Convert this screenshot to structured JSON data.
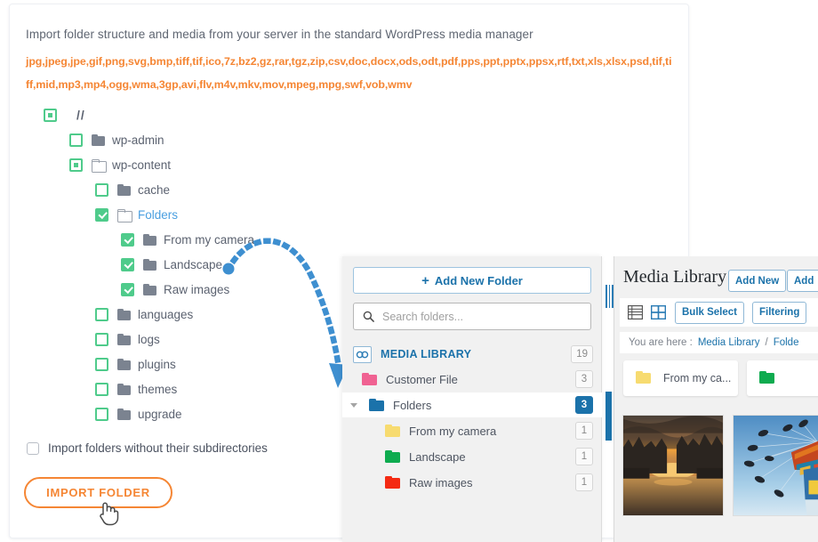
{
  "import_panel": {
    "intro": "Import folder structure and media from your server in the standard WordPress media manager",
    "extensions": "jpg,jpeg,jpe,gif,png,svg,bmp,tiff,tif,ico,7z,bz2,gz,rar,tgz,zip,csv,doc,docx,ods,odt,pdf,pps,ppt,pptx,ppsx,rtf,txt,xls,xlsx,psd,tif,tiff,mid,mp3,mp4,ogg,wma,3gp,avi,flv,m4v,mkv,mov,mpeg,mpg,swf,vob,wmv",
    "accent_color": "#f58634",
    "check_color": "#4fcb8b",
    "root_label": "//",
    "tree": [
      {
        "label": "wp-admin",
        "depth": 1,
        "state": "unchecked",
        "icon": "folder-solid-icon",
        "selected": false
      },
      {
        "label": "wp-content",
        "depth": 1,
        "state": "indeterminate",
        "icon": "folder-open-icon",
        "selected": false
      },
      {
        "label": "cache",
        "depth": 2,
        "state": "unchecked",
        "icon": "folder-solid-icon",
        "selected": false
      },
      {
        "label": "Folders",
        "depth": 2,
        "state": "checked",
        "icon": "folder-open-icon",
        "selected": true
      },
      {
        "label": "From my camera",
        "depth": 3,
        "state": "checked",
        "icon": "folder-solid-icon",
        "selected": false
      },
      {
        "label": "Landscape",
        "depth": 3,
        "state": "checked",
        "icon": "folder-solid-icon",
        "selected": false
      },
      {
        "label": "Raw images",
        "depth": 3,
        "state": "checked",
        "icon": "folder-solid-icon",
        "selected": false
      },
      {
        "label": "languages",
        "depth": 2,
        "state": "unchecked",
        "icon": "folder-solid-icon",
        "selected": false
      },
      {
        "label": "logs",
        "depth": 2,
        "state": "unchecked",
        "icon": "folder-solid-icon",
        "selected": false
      },
      {
        "label": "plugins",
        "depth": 2,
        "state": "unchecked",
        "icon": "folder-solid-icon",
        "selected": false
      },
      {
        "label": "themes",
        "depth": 2,
        "state": "unchecked",
        "icon": "folder-solid-icon",
        "selected": false
      },
      {
        "label": "upgrade",
        "depth": 2,
        "state": "unchecked",
        "icon": "folder-solid-icon",
        "selected": false
      }
    ],
    "subdir_option_label": "Import folders without their subdirectories",
    "subdir_option_checked": false,
    "import_button_label": "IMPORT FOLDER"
  },
  "folder_panel": {
    "add_new_folder_label": "Add New Folder",
    "add_new_folder_plus": "+",
    "search_placeholder": "Search folders...",
    "media_library_label": "MEDIA LIBRARY",
    "media_library_count": "19",
    "items": [
      {
        "label": "Customer File",
        "count": "3",
        "color": "#f06292",
        "depth": 1,
        "active": false,
        "caret": false
      },
      {
        "label": "Folders",
        "count": "3",
        "color": "#1b72aa",
        "depth": 1,
        "active": true,
        "caret": true
      },
      {
        "label": "From my camera",
        "count": "1",
        "color": "#f7db70",
        "depth": 2,
        "active": false,
        "caret": false
      },
      {
        "label": "Landscape",
        "count": "1",
        "color": "#0eab4f",
        "depth": 2,
        "active": false,
        "caret": false
      },
      {
        "label": "Raw images",
        "count": "1",
        "color": "#f42a13",
        "depth": 2,
        "active": false,
        "caret": false
      }
    ]
  },
  "media_panel": {
    "title": "Media Library",
    "add_new_label": "Add New",
    "add_second_label": "Add",
    "bulk_select_label": "Bulk Select",
    "filtering_label": "Filtering",
    "breadcrumb_prefix": "You are here  :",
    "breadcrumb_root": "Media Library",
    "breadcrumb_sep": "/",
    "breadcrumb_current": "Folde",
    "folder_cards": [
      {
        "label": "From my ca...",
        "color": "#f7db70"
      },
      {
        "label": "",
        "color": "#0eab4f"
      }
    ],
    "thumbnails": [
      {
        "name": "canal-sunset-photo"
      },
      {
        "name": "carnival-swing-ride-photo"
      }
    ]
  }
}
